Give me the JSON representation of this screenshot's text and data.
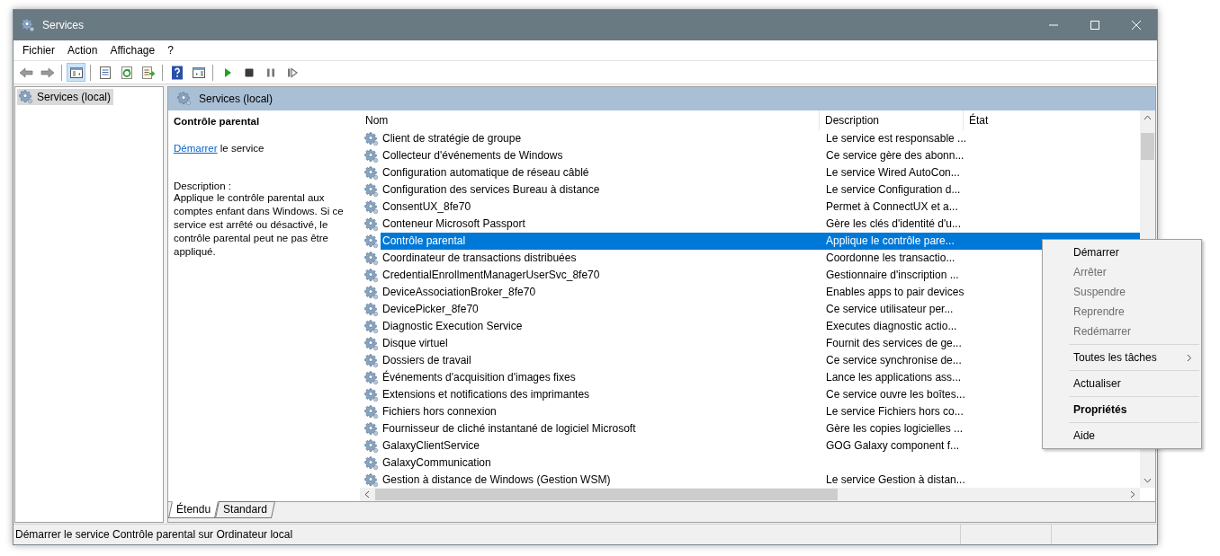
{
  "window": {
    "title": "Services"
  },
  "menu": [
    "Fichier",
    "Action",
    "Affichage",
    "?"
  ],
  "toolbar": [
    {
      "kind": "back",
      "selected": false
    },
    {
      "kind": "forward",
      "selected": false
    },
    {
      "kind": "separator"
    },
    {
      "kind": "tree",
      "selected": true
    },
    {
      "kind": "separator"
    },
    {
      "kind": "properties",
      "selected": false
    },
    {
      "kind": "refresh",
      "selected": false
    },
    {
      "kind": "export",
      "selected": false
    },
    {
      "kind": "separator"
    },
    {
      "kind": "help",
      "selected": false
    },
    {
      "kind": "pane",
      "selected": false
    },
    {
      "kind": "separator"
    },
    {
      "kind": "play",
      "selected": false
    },
    {
      "kind": "stop",
      "selected": false
    },
    {
      "kind": "pause",
      "selected": false
    },
    {
      "kind": "resume",
      "selected": false
    }
  ],
  "tree": {
    "items": [
      {
        "label": "Services (local)",
        "selected": true
      }
    ]
  },
  "pane_header": "Services (local)",
  "details": {
    "title": "Contrôle parental",
    "action_link": "Démarrer",
    "action_rest": "le service",
    "description_label": "Description :",
    "description": "Applique le contrôle parental aux comptes enfant dans Windows. Si ce service est arrêté ou désactivé, le contrôle parental peut ne pas être appliqué."
  },
  "table": {
    "columns": [
      "Nom",
      "Description",
      "État"
    ],
    "rows": [
      {
        "name": "Client de stratégie de groupe",
        "description": "Le service est responsable ...",
        "selected": false
      },
      {
        "name": "Collecteur d'événements de Windows",
        "description": "Ce service gère des abonn...",
        "selected": false
      },
      {
        "name": "Configuration automatique de réseau câblé",
        "description": "Le service Wired AutoCon...",
        "selected": false
      },
      {
        "name": "Configuration des services Bureau à distance",
        "description": "Le service Configuration d...",
        "selected": false
      },
      {
        "name": "ConsentUX_8fe70",
        "description": "Permet à ConnectUX et a...",
        "selected": false
      },
      {
        "name": "Conteneur Microsoft Passport",
        "description": "Gère les clés d'identité d'u...",
        "selected": false
      },
      {
        "name": "Contrôle parental",
        "description": "Applique le contrôle pare...",
        "selected": true
      },
      {
        "name": "Coordinateur de transactions distribuées",
        "description": "Coordonne les transactio...",
        "selected": false
      },
      {
        "name": "CredentialEnrollmentManagerUserSvc_8fe70",
        "description": "Gestionnaire d'inscription ...",
        "selected": false
      },
      {
        "name": "DeviceAssociationBroker_8fe70",
        "description": "Enables apps to pair devices",
        "selected": false
      },
      {
        "name": "DevicePicker_8fe70",
        "description": "Ce service utilisateur per...",
        "selected": false
      },
      {
        "name": "Diagnostic Execution Service",
        "description": "Executes diagnostic actio...",
        "selected": false
      },
      {
        "name": "Disque virtuel",
        "description": "Fournit des services de ge...",
        "selected": false
      },
      {
        "name": "Dossiers de travail",
        "description": "Ce service synchronise de...",
        "selected": false
      },
      {
        "name": "Événements d'acquisition d'images fixes",
        "description": "Lance les applications ass...",
        "selected": false
      },
      {
        "name": "Extensions et notifications des imprimantes",
        "description": "Ce service ouvre les boîtes...",
        "selected": false
      },
      {
        "name": "Fichiers hors connexion",
        "description": "Le service Fichiers hors co...",
        "selected": false
      },
      {
        "name": "Fournisseur de cliché instantané de logiciel Microsoft",
        "description": "Gère les copies logicielles ...",
        "selected": false
      },
      {
        "name": "GalaxyClientService",
        "description": "GOG Galaxy component f...",
        "selected": false
      },
      {
        "name": "GalaxyCommunication",
        "selected": false
      },
      {
        "name": "Gestion à distance de Windows (Gestion WSM)",
        "description": "Le service Gestion à distan...",
        "selected": false
      }
    ]
  },
  "view_tabs": [
    {
      "label": "Étendu",
      "selected": true
    },
    {
      "label": "Standard",
      "selected": false
    }
  ],
  "status_bar": "Démarrer le service Contrôle parental sur Ordinateur local",
  "context_menu": [
    {
      "kind": "item",
      "label": "Démarrer",
      "disabled": false,
      "bold": false
    },
    {
      "kind": "item",
      "label": "Arrêter",
      "disabled": true,
      "bold": false
    },
    {
      "kind": "item",
      "label": "Suspendre",
      "disabled": true,
      "bold": false
    },
    {
      "kind": "item",
      "label": "Reprendre",
      "disabled": true,
      "bold": false
    },
    {
      "kind": "item",
      "label": "Redémarrer",
      "disabled": true,
      "bold": false
    },
    {
      "kind": "separator"
    },
    {
      "kind": "submenu",
      "label": "Toutes les tâches",
      "disabled": false,
      "bold": false
    },
    {
      "kind": "separator"
    },
    {
      "kind": "item",
      "label": "Actualiser",
      "disabled": false,
      "bold": false
    },
    {
      "kind": "separator"
    },
    {
      "kind": "item",
      "label": "Propriétés",
      "disabled": false,
      "bold": true
    },
    {
      "kind": "separator"
    },
    {
      "kind": "item",
      "label": "Aide",
      "disabled": false,
      "bold": false
    }
  ]
}
